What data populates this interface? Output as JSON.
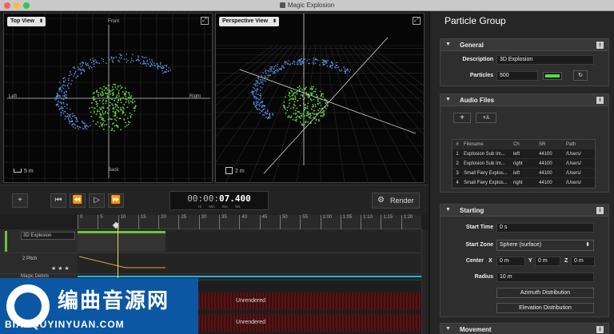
{
  "window": {
    "title": "Magic Explosion",
    "lights": [
      "#fc5f57",
      "#fdbc2e",
      "#33c748"
    ]
  },
  "viewports": {
    "top": {
      "view_label": "Top View",
      "labels": {
        "front": "Front",
        "back": "Back",
        "left": "Left",
        "right": "Right"
      },
      "scale": "5 m"
    },
    "perspective": {
      "view_label": "Perspective View",
      "scale": "2 m"
    }
  },
  "transport": {
    "timecode_dim": "00:00:",
    "timecode_bold": "07.400",
    "units": [
      "Hr",
      "Min",
      "Sec",
      "Ms"
    ],
    "render_label": "Render",
    "icons": [
      "add-icon",
      "skip-back-icon",
      "rewind-icon",
      "play-icon",
      "fast-forward-icon",
      "gear-icon"
    ]
  },
  "timeline": {
    "ruler": [
      "0",
      "5",
      "10",
      "15",
      "20",
      "25",
      "30",
      "35",
      "40",
      "45",
      "50",
      "55",
      "1:00",
      "1:05",
      "1:10",
      "1:15",
      "1:20"
    ],
    "tracks": [
      {
        "name": "3D Explosion"
      },
      {
        "name": "2 Pitch"
      },
      {
        "name": "Magic Debris"
      }
    ],
    "unrendered_label": "Unrendered",
    "colors": {
      "clip_green": "#6ac53c",
      "automation": "#e8a23c",
      "cyan": "#1fb5e6",
      "unrendered": "#4a1212"
    }
  },
  "panel": {
    "title": "Particle Group",
    "general": {
      "title": "General",
      "description_label": "Description",
      "description_value": "3D Explosion",
      "particles_label": "Particles",
      "particles_value": "500",
      "accent": "#54e03c"
    },
    "audio_files": {
      "title": "Audio Files",
      "add_label": "+",
      "add_multi_label": "+⅄",
      "columns": [
        "#",
        "Filename",
        "Ch",
        "SR",
        "Path"
      ],
      "rows": [
        [
          "1",
          "Explosion Sub Im...",
          "left",
          "44100",
          "/Users/"
        ],
        [
          "2",
          "Explosion Sub Im...",
          "right",
          "44100",
          "/Users/"
        ],
        [
          "3",
          "Small Fiery Explos...",
          "left",
          "44100",
          "/Users/"
        ],
        [
          "4",
          "Small Fiery Explos...",
          "right",
          "44100",
          "/Users/"
        ]
      ]
    },
    "starting": {
      "title": "Starting",
      "start_time_label": "Start Time",
      "start_time_value": "0 s",
      "start_zone_label": "Start Zone",
      "start_zone_value": "Sphere (surface)",
      "center_label": "Center",
      "x_label": "X",
      "x_value": "0 m",
      "y_label": "Y",
      "y_value": "0 m",
      "z_label": "Z",
      "z_value": "0 m",
      "radius_label": "Radius",
      "radius_value": "10 m",
      "azimuth_label": "Azimuth Distribution",
      "elevation_label": "Elevation Distribution"
    },
    "movement": {
      "title": "Movement"
    }
  },
  "watermark": {
    "cn": "编曲音源网",
    "en": "BIANQUYINYUAN.COM"
  }
}
